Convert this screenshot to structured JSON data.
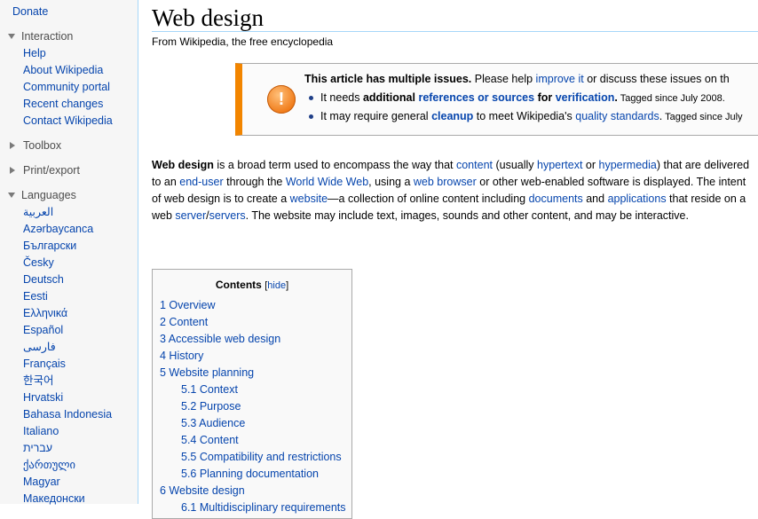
{
  "sidebar": {
    "donate": "Donate",
    "interaction": {
      "heading": "Interaction",
      "items": [
        "Help",
        "About Wikipedia",
        "Community portal",
        "Recent changes",
        "Contact Wikipedia"
      ]
    },
    "toolbox": "Toolbox",
    "print_export": "Print/export",
    "languages": {
      "heading": "Languages",
      "items": [
        "العربية",
        "Azərbaycanca",
        "Български",
        "Česky",
        "Deutsch",
        "Eesti",
        "Ελληνικά",
        "Español",
        "فارسی",
        "Français",
        "한국어",
        "Hrvatski",
        "Bahasa Indonesia",
        "Italiano",
        "עברית",
        "ქართული",
        "Magyar",
        "Македонски"
      ]
    }
  },
  "article": {
    "title": "Web design",
    "tagline": "From Wikipedia, the free encyclopedia"
  },
  "ambox": {
    "icon": "exclamation-icon",
    "line1": {
      "bold": "This article has multiple issues.",
      "t1": " Please help ",
      "link1": "improve it",
      "t2": " or discuss these issues on th"
    },
    "line2": {
      "t1": "It needs ",
      "bold1": "additional ",
      "link1": "references or sources",
      "bold2": " for ",
      "link2": "verification",
      "bold3": ".",
      "small": " Tagged since July 2008."
    },
    "line3": {
      "t1": "It may require general ",
      "link1": "cleanup",
      "t2": " to meet Wikipedia's ",
      "link2": "quality standards",
      "t3": ".",
      "small": " Tagged since July"
    }
  },
  "paragraph": {
    "b1": "Web design",
    "t1": " is a broad term used to encompass the way that ",
    "l1": "content",
    "t2": " (usually ",
    "l2": "hypertext",
    "t3": " or ",
    "l3": "hypermedia",
    "t4": ") that are delivered to an ",
    "l4": "end-user",
    "t5": " through the ",
    "l5": "World Wide Web",
    "t6": ", using a ",
    "l6": "web browser",
    "t7": " or other web-enabled software is displayed. The intent of web design is to create a ",
    "l7": "website",
    "t8": "—a collection of online content including ",
    "l8": "documents",
    "t9": " and ",
    "l9": "applications",
    "t10": " that reside on a web ",
    "l10": "server",
    "t11": "/",
    "l11": "servers",
    "t12": ". The website may include text, images, sounds and other content, and may be interactive."
  },
  "toc": {
    "title": "Contents",
    "hide_open": "[",
    "hide": "hide",
    "hide_close": "]",
    "items": [
      {
        "label": "1 Overview",
        "sub": false
      },
      {
        "label": "2 Content",
        "sub": false
      },
      {
        "label": "3 Accessible web design",
        "sub": false
      },
      {
        "label": "4 History",
        "sub": false
      },
      {
        "label": "5 Website planning",
        "sub": false
      },
      {
        "label": "5.1 Context",
        "sub": true
      },
      {
        "label": "5.2 Purpose",
        "sub": true
      },
      {
        "label": "5.3 Audience",
        "sub": true
      },
      {
        "label": "5.4 Content",
        "sub": true
      },
      {
        "label": "5.5 Compatibility and restrictions",
        "sub": true
      },
      {
        "label": "5.6 Planning documentation",
        "sub": true
      },
      {
        "label": "6 Website design",
        "sub": false
      },
      {
        "label": "6.1 Multidisciplinary requirements",
        "sub": true
      }
    ]
  }
}
